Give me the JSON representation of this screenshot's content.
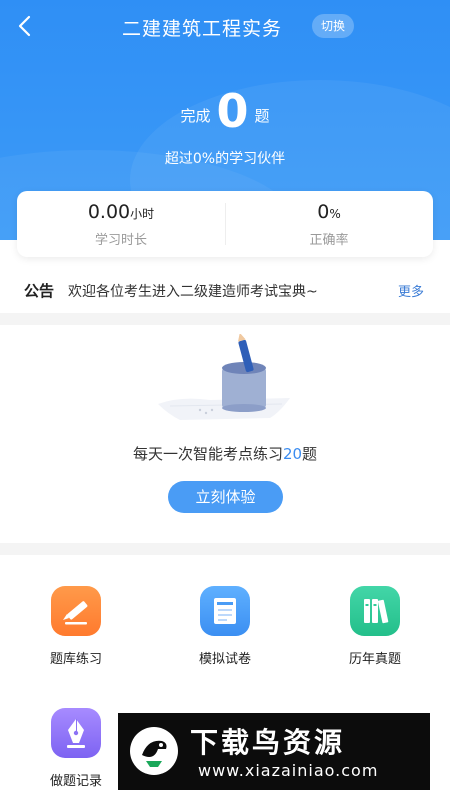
{
  "header": {
    "title": "二建建筑工程实务",
    "switch_label": "切换",
    "back_icon": "chevron-left-icon"
  },
  "progress": {
    "prefix": "完成",
    "count": "0",
    "suffix": "题",
    "beat_text": "超过0%的学习伙伴"
  },
  "stats": {
    "study_time_value": "0.00",
    "study_time_unit": "小时",
    "study_time_label": "学习时长",
    "accuracy_value": "0",
    "accuracy_unit": "%",
    "accuracy_label": "正确率"
  },
  "notice": {
    "tag": "公告",
    "text": "欢迎各位考生进入二级建造师考试宝典~",
    "more": "更多"
  },
  "daily": {
    "text_before": "每天一次智能考点练习",
    "count": "20",
    "text_after": "题",
    "button": "立刻体验"
  },
  "grid": [
    {
      "label": "题库练习",
      "icon": "pencil-icon",
      "color": "#ff8a3a"
    },
    {
      "label": "模拟试卷",
      "icon": "test-paper-icon",
      "color": "#4a9cf5"
    },
    {
      "label": "历年真题",
      "icon": "books-icon",
      "color": "#2fcb97"
    },
    {
      "label": "做题记录",
      "icon": "pen-nib-icon",
      "color": "#8c72f5"
    }
  ],
  "watermark": {
    "title": "下载鸟资源",
    "url": "www.xiazainiao.com"
  },
  "colors": {
    "primary": "#2f8ff5",
    "accent_text": "#3b8cf0"
  }
}
